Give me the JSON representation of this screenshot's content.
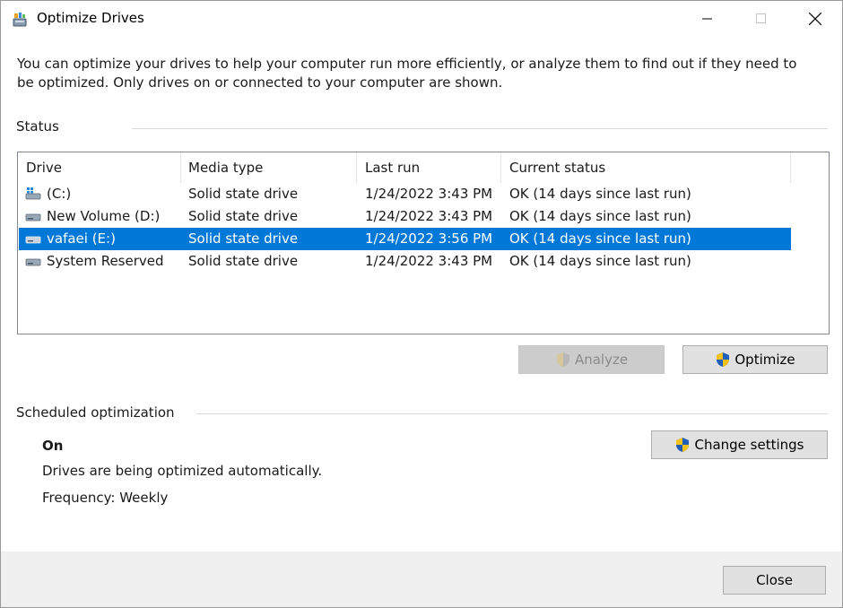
{
  "window": {
    "title": "Optimize Drives",
    "minimize_icon": "minimize-icon",
    "maximize_icon": "maximize-icon",
    "close_icon": "close-icon"
  },
  "intro": "You can optimize your drives to help your computer run more efficiently, or analyze them to find out if they need to be optimized. Only drives on or connected to your computer are shown.",
  "status": {
    "label": "Status",
    "columns": [
      "Drive",
      "Media type",
      "Last run",
      "Current status"
    ],
    "rows": [
      {
        "drive": "(C:)",
        "icon": "system-drive-icon",
        "media": "Solid state drive",
        "last_run": "1/24/2022 3:43 PM",
        "status": "OK (14 days since last run)",
        "selected": false
      },
      {
        "drive": "New Volume (D:)",
        "icon": "drive-icon",
        "media": "Solid state drive",
        "last_run": "1/24/2022 3:43 PM",
        "status": "OK (14 days since last run)",
        "selected": false
      },
      {
        "drive": "vafaei (E:)",
        "icon": "drive-icon",
        "media": "Solid state drive",
        "last_run": "1/24/2022 3:56 PM",
        "status": "OK (14 days since last run)",
        "selected": true
      },
      {
        "drive": "System Reserved",
        "icon": "drive-icon",
        "media": "Solid state drive",
        "last_run": "1/24/2022 3:43 PM",
        "status": "OK (14 days since last run)",
        "selected": false
      }
    ]
  },
  "actions": {
    "analyze": "Analyze",
    "optimize": "Optimize"
  },
  "scheduled": {
    "label": "Scheduled optimization",
    "state": "On",
    "description": "Drives are being optimized automatically.",
    "frequency": "Frequency: Weekly",
    "change_settings": "Change settings"
  },
  "footer": {
    "close": "Close"
  },
  "colors": {
    "selection": "#0078d7",
    "button_face": "#e1e1e1",
    "footer_bg": "#f0f0f0"
  }
}
